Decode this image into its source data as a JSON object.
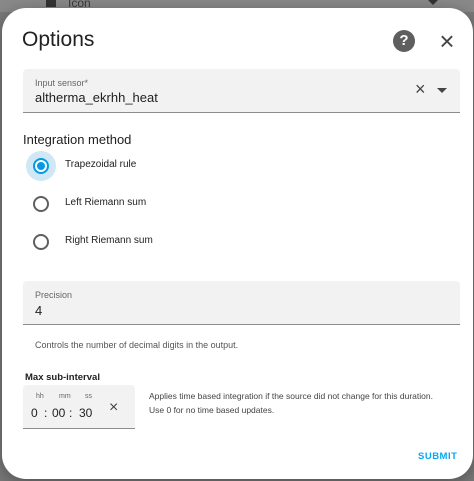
{
  "background": {
    "field_label": "Icon"
  },
  "dialog": {
    "title": "Options",
    "help_icon": "help-circle-icon",
    "close_icon": "close-icon",
    "close_glyph": "×"
  },
  "input_sensor": {
    "label": "Input sensor*",
    "value": "altherma_ekrhh_heat",
    "clear_glyph": "×"
  },
  "integration_method": {
    "label": "Integration method",
    "options": [
      {
        "label": "Trapezoidal rule",
        "selected": true
      },
      {
        "label": "Left Riemann sum",
        "selected": false
      },
      {
        "label": "Right Riemann sum",
        "selected": false
      }
    ]
  },
  "precision": {
    "label": "Precision",
    "value": "4",
    "helper": "Controls the number of decimal digits in the output."
  },
  "max_sub_interval": {
    "label": "Max sub-interval",
    "units": {
      "hh": "hh",
      "mm": "mm",
      "ss": "ss"
    },
    "values": {
      "hh": "0",
      "mm": "00",
      "ss": "30"
    },
    "sep": ":",
    "clear_glyph": "×",
    "description": "Applies time based integration if the source did not change for this duration. Use 0 for no time based updates."
  },
  "actions": {
    "submit": "SUBMIT"
  },
  "colors": {
    "accent": "#03a9f4",
    "radio_selected": "#039be5",
    "radio_halo": "#cfe8f6"
  }
}
